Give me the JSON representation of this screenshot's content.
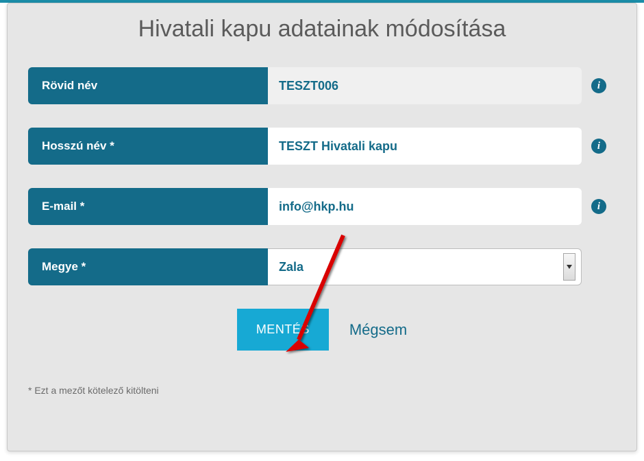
{
  "modal": {
    "title": "Hivatali kapu adatainak módosítása",
    "footnote": "* Ezt a mezőt kötelező kitölteni"
  },
  "fields": {
    "short_name": {
      "label": "Rövid név",
      "value": "TESZT006"
    },
    "long_name": {
      "label": "Hosszú név *",
      "value": "TESZT Hivatali kapu"
    },
    "email": {
      "label": "E-mail *",
      "value": "info@hkp.hu"
    },
    "county": {
      "label": "Megye *",
      "value": "Zala"
    }
  },
  "buttons": {
    "save": "MENTÉS",
    "cancel": "Mégsem"
  },
  "icons": {
    "info": "i"
  }
}
